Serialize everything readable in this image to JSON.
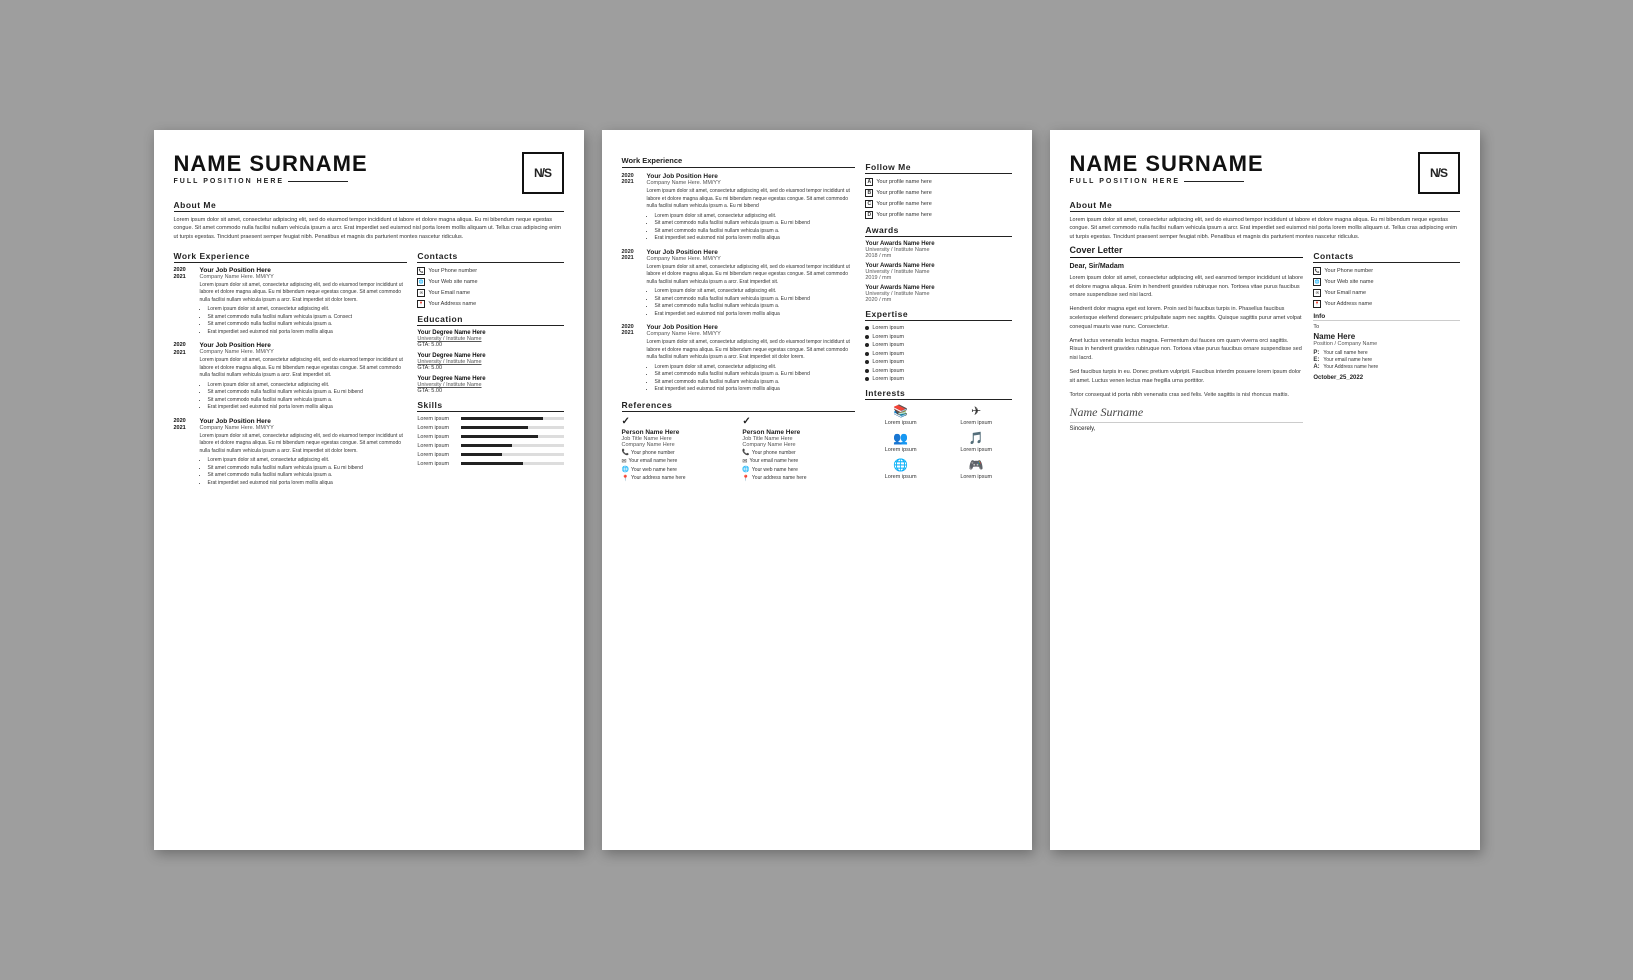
{
  "background": "#9e9e9e",
  "pages": [
    {
      "id": "page1",
      "type": "resume-main",
      "header": {
        "name": "NAME SURNAME",
        "position": "FULL POSITION HERE",
        "logo": "N/S"
      },
      "about": {
        "title": "About Me",
        "text": "Lorem ipsum dolor sit amet, consectetur adipiscing elit, sed do eiusmod tempor incididunt ut labore et dolore magna aliqua. Eu mi bibendum neque egestas congue. Sit amet commodo nulla facilisi nullam vehicula ipsum a arcr. Erat imperdiet sed euismod nisl porta lorem mollis aliquam ut. Tellus cras adipiscing enim ut turpis egestas. Tincidunt praesent semper feugiat nibh. Penatibus et magnis dis parturient montes nascetur ridiculus."
      },
      "work_experience": {
        "title": "Work Experience",
        "items": [
          {
            "year_start": "2020",
            "year_end": "2021",
            "job_title": "Your Job Position Here",
            "company": "Company Name Here. MM/YY",
            "desc": "Lorem ipsum dolor sit amet, consectetur adipiscing elit, sed do eiusmod tempor incididunt ut labore et dolore magna aliqua. Eu mi bibendum neque egestas congue. Sit amet commodo nulla facilisi nullam vehicula ipsum a arcr. Erat imperdiet sit dolor lorem.",
            "bullets": [
              "Lorem ipsum dolor sit amet, consectetur adipiscing elit.",
              "Sit amet commodo nulla facilisi nullam vehicula ipsum a. Consect",
              "Sit amet commodo nulla facilisi nullam vehicula ipsum a.",
              "Erat imperdiet sed euismod nisl porta lorem mollis aliqua"
            ]
          },
          {
            "year_start": "2020",
            "year_end": "2021",
            "job_title": "Your Job Position Here",
            "company": "Company Name Here. MM/YY",
            "desc": "Lorem ipsum dolor sit amet, consectetur adipiscing elit, sed do eiusmod tempor incididunt ut labore et dolore magna aliqua. Eu mi bibendum neque egestas congue. Sit amet commodo nulla facilisi nullam vehicula ipsum a arcr. Erat imperdiet sit.",
            "bullets": [
              "Lorem ipsum dolor sit amet, consectetur adipiscing elit.",
              "Sit amet commodo nulla facilisi nullam vehicula ipsum a. Eu mi bibend",
              "Sit amet commodo nulla facilisi nullam vehicula ipsum a.",
              "Erat imperdiet sed euismod nisl porta lorem mollis aliqua"
            ]
          },
          {
            "year_start": "2020",
            "year_end": "2021",
            "job_title": "Your Job Position Here",
            "company": "Company Name Here. MM/YY",
            "desc": "Lorem ipsum dolor sit amet, consectetur adipiscing elit, sed do eiusmod tempor incididunt ut labore et dolore magna aliqua. Eu mi bibendum neque egestas congue. Sit amet commodo nulla facilisi nullam vehicula ipsum a arcr. Erat imperdiet sit dolor lorem.",
            "bullets": [
              "Lorem ipsum dolor sit amet, consectetur adipiscing elit.",
              "Sit amet commodo nulla facilisi nullam vehicula ipsum a. Eu mi bibend",
              "Sit amet commodo nulla facilisi nullam vehicula ipsum a.",
              "Erat imperdiet sed euismod nisl porta lorem mollis aliqua"
            ]
          }
        ]
      },
      "contacts": {
        "title": "Contacts",
        "items": [
          {
            "icon": "📞",
            "label": "Your Phone number"
          },
          {
            "icon": "🌐",
            "label": "Your Web site name"
          },
          {
            "icon": "✉",
            "label": "Your Email name"
          },
          {
            "icon": "📍",
            "label": "Your Address name"
          }
        ]
      },
      "education": {
        "title": "Education",
        "items": [
          {
            "degree": "Your Degree Name Here",
            "university": "University / Institute Name",
            "gta": "GTA: 5.00"
          },
          {
            "degree": "Your Degree Name Here",
            "university": "University / Institute Name",
            "gta": "GTA: 5.00"
          },
          {
            "degree": "Your Degree Name Here",
            "university": "University / Institute Name",
            "gta": "GTA: 5.00"
          }
        ]
      },
      "skills": {
        "title": "Skills",
        "items": [
          {
            "label": "Lorem ipsum",
            "percent": 80
          },
          {
            "label": "Lorem ipsum",
            "percent": 65
          },
          {
            "label": "Lorem ipsum",
            "percent": 75
          },
          {
            "label": "Lorem ipsum",
            "percent": 50
          },
          {
            "label": "Lorem ipsum",
            "percent": 40
          },
          {
            "label": "Lorem ipsum",
            "percent": 60
          }
        ]
      }
    },
    {
      "id": "page2",
      "type": "resume-page2",
      "work_experience": {
        "title": "Work Experience",
        "items": [
          {
            "year_start": "2020",
            "year_end": "2021",
            "job_title": "Your Job Position Here",
            "company": "Company Name Here. MM/YY",
            "desc": "Lorem ipsum dolor sit amet, consectetur adipiscing elit, sed do eiusmod tempor incididunt ut labore et dolore magna aliqua. Eu mi bibendum neque egestas congue. Sit amet commodo nulla facilisi nullam vehicula ipsum a. Eu mi bibend",
            "bullets": [
              "Lorem ipsum dolor sit amet, consectetur adipiscing elit.",
              "Sit amet commodo nulla facilisi nullam vehicula ipsum a. Eu mi bibend",
              "Sit amet commodo nulla facilisi nullam vehicula ipsum a.",
              "Erat imperdiet sed euismod nisl porta lorem mollis aliqua"
            ]
          },
          {
            "year_start": "2020",
            "year_end": "2021",
            "job_title": "Your Job Position Here",
            "company": "Company Name Here. MM/YY",
            "desc": "Lorem ipsum dolor sit amet, consectetur adipiscing elit, sed do eiusmod tempor incididunt ut labore et dolore magna aliqua. Eu mi bibendum neque egestas congue. Sit amet commodo nulla facilisi nullam vehicula ipsum a arcr. Erat imperdiet sit.",
            "bullets": [
              "Lorem ipsum dolor sit amet, consectetur adipiscing elit.",
              "Sit amet commodo nulla facilisi nullam vehicula ipsum a. Eu mi bibend",
              "Sit amet commodo nulla facilisi nullam vehicula ipsum a.",
              "Erat imperdiet sed euismod nisl porta lorem mollis aliqua"
            ]
          },
          {
            "year_start": "2020",
            "year_end": "2021",
            "job_title": "Your Job Position Here",
            "company": "Company Name Here. MM/YY",
            "desc": "Lorem ipsum dolor sit amet, consectetur adipiscing elit, sed do eiusmod tempor incididunt ut labore et dolore magna aliqua. Eu mi bibendum neque egestas congue. Sit amet commodo nulla facilisi nullam vehicula ipsum a arcr. Erat imperdiet sit dolor lorem.",
            "bullets": [
              "Lorem ipsum dolor sit amet, consectetur adipiscing elit.",
              "Sit amet commodo nulla facilisi nullam vehicula ipsum a. Eu mi bibend",
              "Sit amet commodo nulla facilisi nullam vehicula ipsum a.",
              "Erat imperdiet sed euismod nisl porta lorem mollis aliqua"
            ]
          }
        ]
      },
      "follow_me": {
        "title": "Follow Me",
        "items": [
          {
            "letter": "A",
            "label": "Your profile name here"
          },
          {
            "letter": "B",
            "label": "Your profile name here"
          },
          {
            "letter": "C",
            "label": "Your profile name here"
          },
          {
            "letter": "D",
            "label": "Your profile name here"
          }
        ]
      },
      "awards": {
        "title": "Awards",
        "items": [
          {
            "name": "Your Awards Name Here",
            "org": "University / Institute Name",
            "year": "2018 / mm"
          },
          {
            "name": "Your Awards Name Here",
            "org": "University / Institute Name",
            "year": "2019 / mm"
          },
          {
            "name": "Your Awards Name Here",
            "org": "University / Institute Name",
            "year": "2020 / mm"
          }
        ]
      },
      "expertise": {
        "title": "Expertise",
        "items": [
          "Lorem ipsum",
          "Lorem ipsum",
          "Lorem ipsum",
          "Lorem ipsum",
          "Lorem ipsum",
          "Lorem ipsum",
          "Lorem ipsum"
        ]
      },
      "interests": {
        "title": "Interests",
        "items": [
          {
            "icon": "📚",
            "label": "Lorem ipsum"
          },
          {
            "icon": "✈",
            "label": "Lorem ipsum"
          },
          {
            "icon": "👥",
            "label": "Lorem ipsum"
          },
          {
            "icon": "🎵",
            "label": "Lorem ipsum"
          },
          {
            "icon": "🌐",
            "label": "Lorem ipsum"
          },
          {
            "icon": "🎮",
            "label": "Lorem ipsum"
          }
        ]
      },
      "references": {
        "title": "References",
        "items": [
          {
            "name": "Person Name Here",
            "title": "Job Title Name Here",
            "company": "Company Name Here",
            "phone": "Your phone number",
            "email": "Your email name here",
            "web": "Your web name here",
            "address": "Your address name here"
          },
          {
            "name": "Person Name Here",
            "title": "Job Title Name Here",
            "company": "Company Name Here",
            "phone": "Your phone number",
            "email": "Your email name here",
            "web": "Your web name here",
            "address": "Your address name here"
          }
        ]
      }
    },
    {
      "id": "page3",
      "type": "cover-letter",
      "header": {
        "name": "NAME SURNAME",
        "position": "FULL POSITION HERE",
        "logo": "N/S"
      },
      "about": {
        "title": "About Me",
        "text": "Lorem ipsum dolor sit amet, consectetur adipiscing elit, sed do eiusmod tempor incididunt ut labore et dolore magna aliqua. Eu mi bibendum neque egestas congue. Sit amet commodo nulla facilisi nullam vehicula ipsum a arcr. Erat imperdiet sed euismod nisl porta lorem mollis aliquam ut. Tellus cras adipiscing enim ut turpis egestas. Tincidunt praesent semper feugiat nibh. Penatibus et magnis dis parturient montes nascetur ridiculus."
      },
      "cover_letter": {
        "title": "Cover Letter",
        "salutation": "Dear, Sir/Madam",
        "paragraphs": [
          "Lorem ipsum dolor sit amet, consectetur adipiscing elit, sed earsmod tempor incididunt ut labore et dolore magna aliqua. Enim in hendrerit gravides rubiruque non. Tortoea vitae purus faucibus ornare suspendisse sed nisi lacrd.",
          "Hendrerit dolor magna eget est lorem. Proin sed bi faucibus turpis in. Phasellus faucibus scelerisque eleifend doneaerc priulpultate sapm nec sagittis. Quisque sagittis purur amet volpat conequal mauris wae nunc. Consectetur.",
          "Amet luctus venenatis lectus magna. Fermentum dui fauces om quam viverra orci sagittis. Risus in hendrerit gravides rubiruque non. Tortoea vitae purus faucibus ornare suspendisse sed nisi lacrd.",
          "Sed faucibus turpis in eu. Donec pretium vulpripit. Faucibus interdm posuere lorem ipsum dolor sit amet. Luctus venen lectus mae fregilla urna porttitor.",
          "Tortor consequat id porta nibh venenatis cras sed felis. Veite sagittis is nisl rhoncus mattis."
        ],
        "signature": "Name Surname",
        "sincerely": "Sincerely,"
      },
      "contacts": {
        "title": "Contacts",
        "items": [
          {
            "icon": "📞",
            "label": "Your Phone number"
          },
          {
            "icon": "🌐",
            "label": "Your Web site name"
          },
          {
            "icon": "✉",
            "label": "Your Email name"
          },
          {
            "icon": "📍",
            "label": "Your Address name"
          }
        ]
      },
      "info": {
        "title": "Info",
        "to_label": "To",
        "to_name": "Name Here",
        "to_position": "Position / Company Name",
        "contacts": [
          {
            "letter": "P:",
            "value": "Your call name here"
          },
          {
            "letter": "E:",
            "value": "Your email name here"
          },
          {
            "letter": "A:",
            "value": "Your Address name here"
          }
        ],
        "date": "October_25_2022"
      }
    }
  ]
}
